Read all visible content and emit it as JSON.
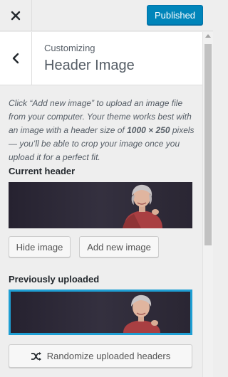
{
  "top_bar": {
    "close_icon": "close-icon",
    "published_label": "Published",
    "published_color": "#0085ba"
  },
  "section": {
    "back_icon": "chevron-left-icon",
    "breadcrumb": "Customizing",
    "title": "Header Image"
  },
  "content": {
    "description_lead": "Click “Add new image” to upload an image file from your computer. Your theme works best with an image with a header size of ",
    "description_size": "1000 × 250",
    "description_tail": " pixels — you’ll be able to crop your image once you upload it for a perfect fit.",
    "current_header_label": "Current header",
    "hide_image_label": "Hide image",
    "add_new_image_label": "Add new image",
    "previously_uploaded_label": "Previously uploaded",
    "randomize_label": "Randomize uploaded headers",
    "randomize_icon": "shuffle-icon",
    "selected_border_color": "#1e9fd4"
  }
}
